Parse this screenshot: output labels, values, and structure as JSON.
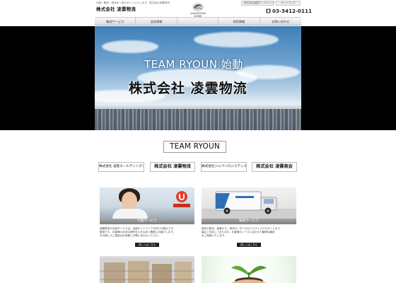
{
  "header": {
    "tagline": "引越・輸送・物流を一括サポートいたします。株式会社凌雲物流",
    "company_logo": "株式会社 凌雲物流",
    "center_logo_text": "teamRYOUN",
    "center_logo_sub": "HOME",
    "links": [
      "株式会社凌雲ホールディングス",
      "サイトマップ"
    ],
    "phone": "03-3412-0111"
  },
  "nav": [
    "輸送サービス",
    "会社情報",
    "",
    "採用情報",
    "お問い合わせ"
  ],
  "hero": {
    "line1": "TEAM RYOUN 始動",
    "line2": "株式会社 凌雲物流"
  },
  "team_logo": "TEAM RYOUN",
  "group_logos": [
    {
      "label": "株式会社 凌雲ホールディングス",
      "style": "small"
    },
    {
      "label": "株式会社 凌雲物流",
      "style": "big"
    },
    {
      "label": "株式会社ジャパンロジスティクス",
      "style": "small"
    },
    {
      "label": "株式会社 凌雲商会",
      "style": "big"
    }
  ],
  "cards": [
    {
      "title": "引越サービス",
      "text_lines": [
        "凌雲物流の引越サービスは、全国ネットワークを持つ引越のプロ",
        "集団です。お客様の大切な家財を心を込めて確実にお届けします。",
        "お引越しのご相談はお気軽にお問い合わせください。"
      ],
      "button": "詳しくはこちら",
      "badge": "U"
    },
    {
      "title": "輸送サービス",
      "text_lines": [
        "国内の配送、保管から、物流センターのロジスティクスサポートまで",
        "幅広く対応しております。お客様のニーズに合わせた最適な輸送",
        "をご提案いたします。"
      ],
      "button": "詳しくはこちら"
    }
  ]
}
